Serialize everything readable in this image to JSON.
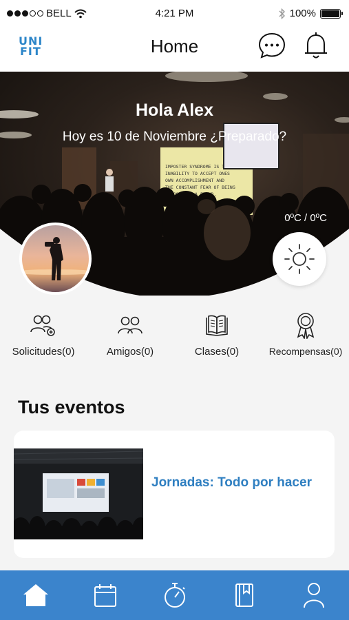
{
  "status_bar": {
    "carrier": "BELL",
    "time": "4:21 PM",
    "battery": "100%",
    "battery_level": 1.0
  },
  "header": {
    "logo_line1": "UNI",
    "logo_line2": "FIT",
    "title": "Home"
  },
  "hero": {
    "greeting": "Hola Alex",
    "subtitle": "Hoy es 10 de Noviembre ¿Preparado?",
    "temperature": "0ºC / 0ºC",
    "screen_text": "IMPOSTER SYNDROME IS THE INABILITY TO ACCEPT ONES OWN ACCOMPLISHMENT AND THE CONSTANT FEAR OF BEING EXPOSED AS A FRAUD."
  },
  "stats": [
    {
      "label": "Solicitudes(0)",
      "icon": "add-users-icon"
    },
    {
      "label": "Amigos(0)",
      "icon": "users-icon"
    },
    {
      "label": "Clases(0)",
      "icon": "book-icon"
    },
    {
      "label": "Recompensas(0)",
      "icon": "award-icon"
    }
  ],
  "events": {
    "section_title": "Tus eventos",
    "items": [
      {
        "title": "Jornadas: Todo por hacer"
      }
    ]
  },
  "bottom_nav": [
    {
      "icon": "home-icon"
    },
    {
      "icon": "calendar-icon"
    },
    {
      "icon": "stopwatch-icon"
    },
    {
      "icon": "bookmark-book-icon"
    },
    {
      "icon": "profile-icon"
    }
  ],
  "colors": {
    "accent": "#3b84cc",
    "event_title": "#2f7fc1",
    "logo": "#2d86c9"
  }
}
